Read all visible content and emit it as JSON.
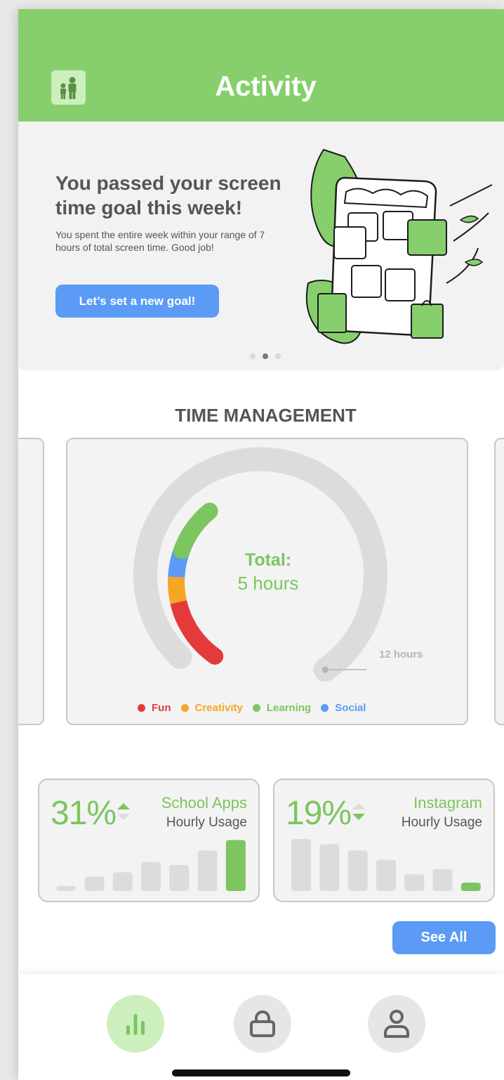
{
  "header": {
    "title": "Activity",
    "family_icon": "family-icon"
  },
  "banner": {
    "heading": "You passed your screen time goal this week!",
    "body": "You spent the entire week within your range of 7 hours of total screen time. Good job!",
    "button_label": "Let’s set a new goal!",
    "carousel": {
      "count": 3,
      "active_index": 1
    }
  },
  "time_management": {
    "title": "TIME MANAGEMENT",
    "total_label": "Total:",
    "total_value": "5 hours",
    "max_label": "12 hours",
    "legend": [
      {
        "label": "Fun",
        "color": "#e33b3b"
      },
      {
        "label": "Creativity",
        "color": "#f5a623"
      },
      {
        "label": "Learning",
        "color": "#7cc55f"
      },
      {
        "label": "Social",
        "color": "#5b9bf5"
      }
    ]
  },
  "usage_cards": [
    {
      "percent": "31%",
      "trend": "up",
      "app": "School Apps",
      "subtitle": "Hourly Usage",
      "bars": [
        0.08,
        0.28,
        0.36,
        0.56,
        0.5,
        0.78,
        0.98
      ],
      "highlight_index": 6
    },
    {
      "percent": "19%",
      "trend": "down",
      "app": "Instagram",
      "subtitle": "Hourly Usage",
      "bars": [
        1.0,
        0.9,
        0.78,
        0.6,
        0.32,
        0.42,
        0.16
      ],
      "highlight_index": 6
    }
  ],
  "see_all_label": "See All",
  "colors": {
    "green": "#86cf6c",
    "accent_green": "#7cc55f",
    "blue": "#5b9bf5"
  },
  "nav": [
    {
      "name": "activity",
      "icon": "bar-chart-icon",
      "active": true
    },
    {
      "name": "lock",
      "icon": "lock-icon",
      "active": false
    },
    {
      "name": "profile",
      "icon": "user-icon",
      "active": false
    }
  ]
}
